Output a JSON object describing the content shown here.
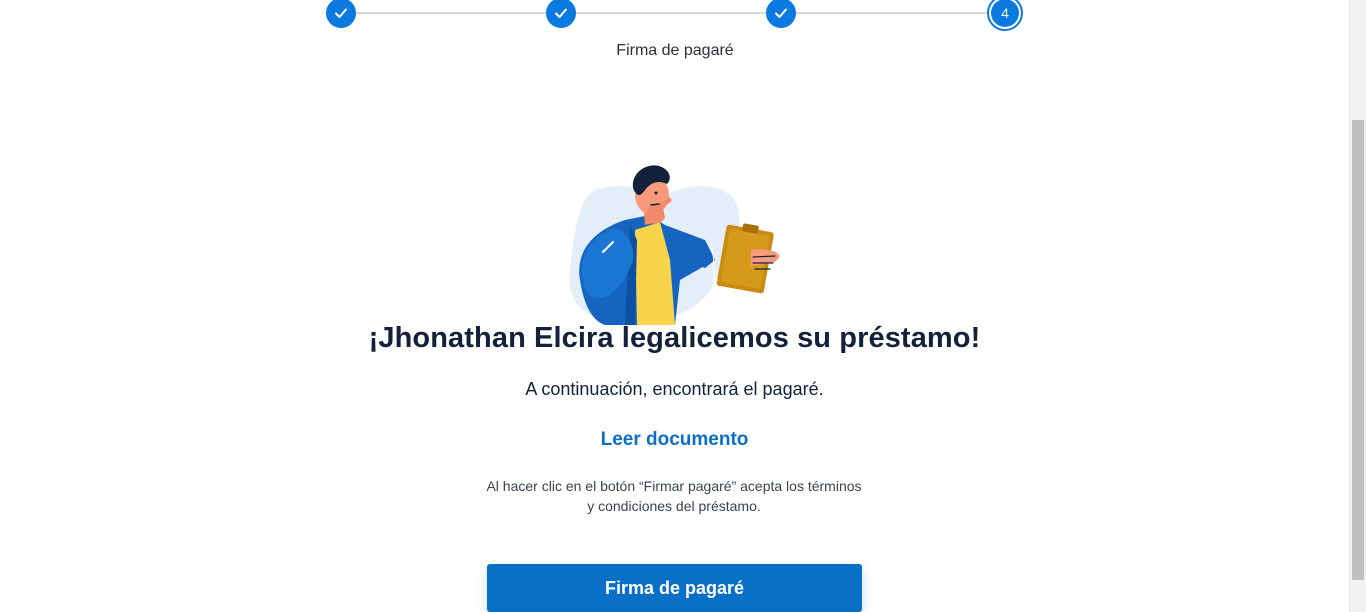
{
  "stepper": {
    "steps": [
      {
        "state": "completed",
        "icon": "check-icon"
      },
      {
        "state": "completed",
        "icon": "check-icon"
      },
      {
        "state": "completed",
        "icon": "check-icon"
      },
      {
        "state": "current",
        "number": "4"
      }
    ],
    "current_label": "Firma de pagaré",
    "accent_color": "#0a7ae0"
  },
  "illustration": {
    "icon": "person-reading-clipboard-illustration"
  },
  "main": {
    "title": "¡Jhonathan Elcira legalicemos su préstamo!",
    "subtitle": "A continuación, encontrará el pagaré.",
    "read_document_link": "Leer documento",
    "terms_line1": "Al hacer clic en el botón “Firmar pagaré” acepta los términos",
    "terms_line2": "y condiciones del préstamo.",
    "sign_button_label": "Firma de pagaré",
    "primary_color": "#0a6fc6"
  }
}
